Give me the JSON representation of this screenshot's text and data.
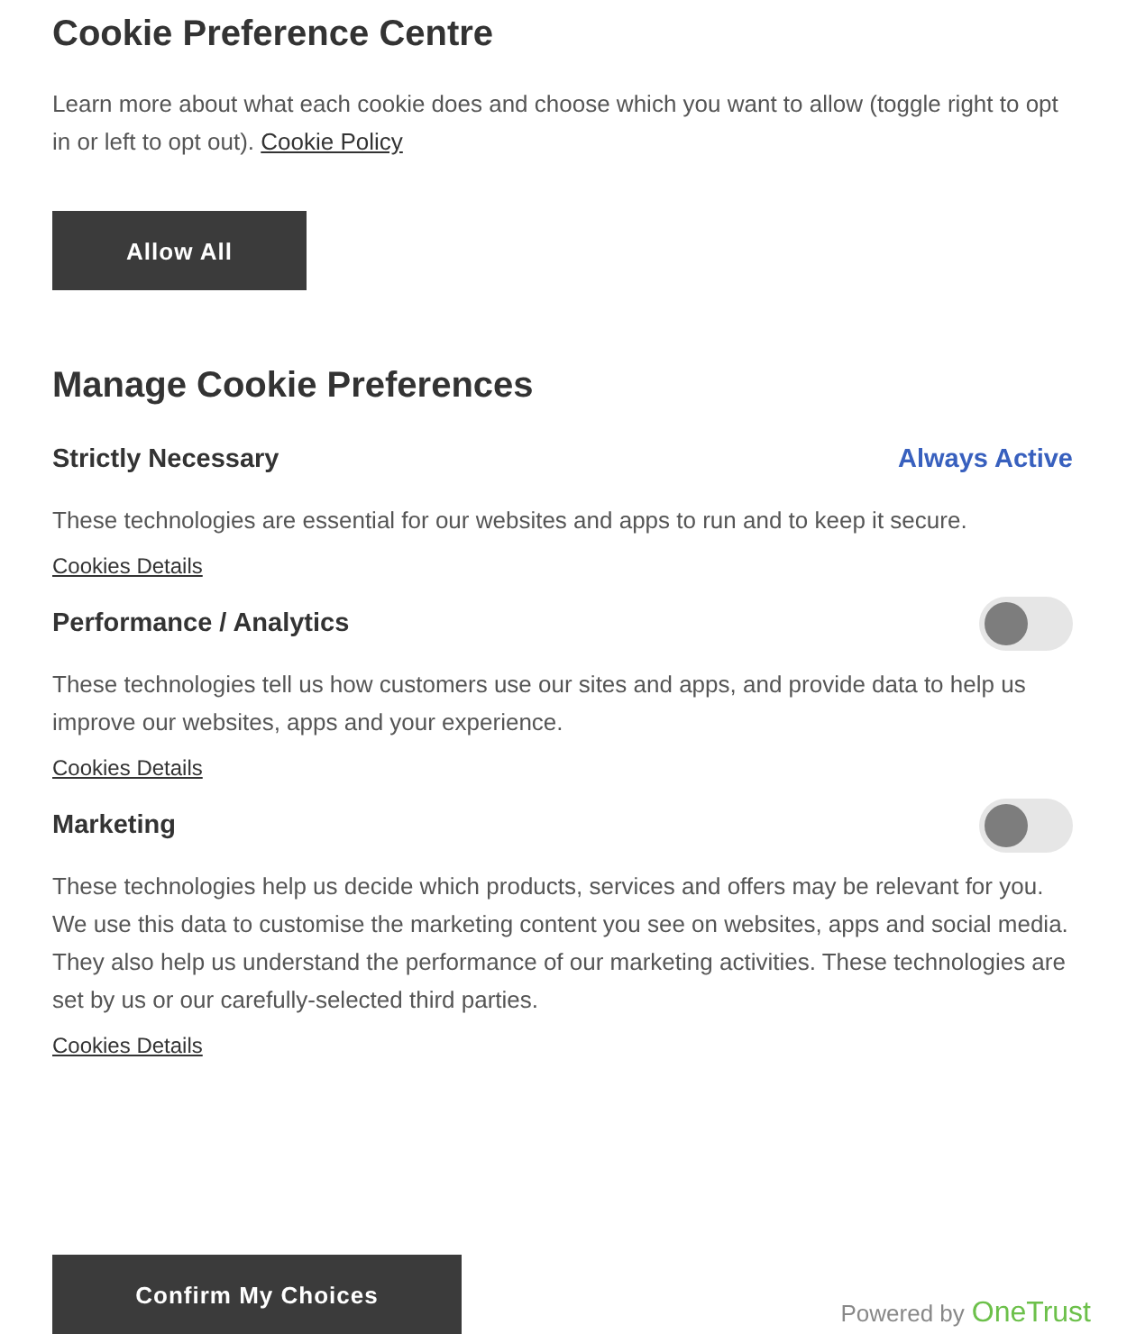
{
  "title": "Cookie Preference Centre",
  "intro": {
    "text": "Learn more about what each cookie does and choose which you want to allow (toggle right to opt in or left to opt out).",
    "link": "Cookie Policy"
  },
  "allow_all": "Allow All",
  "manage_heading": "Manage Cookie Preferences",
  "categories": [
    {
      "name": "Strictly Necessary",
      "kind": "always",
      "status": "Always Active",
      "description": "These technologies are essential for our websites and apps to run and to keep it secure.",
      "details_link": "Cookies Details"
    },
    {
      "name": "Performance / Analytics",
      "kind": "toggle",
      "on": false,
      "description": "These technologies tell us how customers use our sites and apps, and provide data to help us improve our websites, apps and your experience.",
      "details_link": "Cookies Details"
    },
    {
      "name": "Marketing",
      "kind": "toggle",
      "on": false,
      "description": "These technologies help us decide which products, services and offers may be relevant for you. We use this data to customise the marketing content you see on websites, apps and social media. They also help us understand the performance of our marketing activities. These technologies are set by us or our carefully-selected third parties.",
      "details_link": "Cookies Details"
    }
  ],
  "confirm": "Confirm My Choices",
  "powered_by": {
    "label": "Powered by",
    "brand": "OneTrust"
  }
}
